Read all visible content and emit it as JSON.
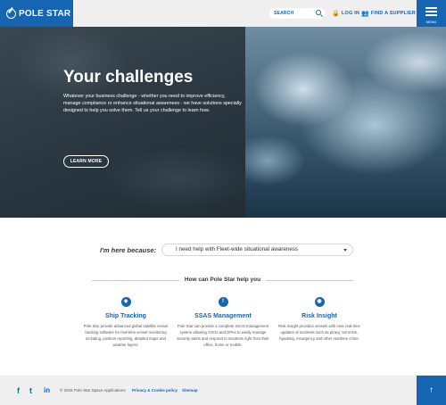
{
  "header": {
    "logo_text": "POLE STAR",
    "search_placeholder": "SEARCH",
    "login_label": "LOG IN",
    "supplier_label": "FIND A SUPPLIER",
    "menu_label": "MENU"
  },
  "hero": {
    "title": "Your challenges",
    "text": "Whatever your business challenge - whether you need to improve efficiency, manage compliance or enhance situational awareness - we have solutions specially designed to help you solve them. Tell us your challenge to learn how.",
    "button_label": "LEARN MORE"
  },
  "selector": {
    "label": "I'm here because:",
    "selected": "I need help with Fleet-wide situational awareness"
  },
  "how": {
    "title": "How can Pole Star help you"
  },
  "features": [
    {
      "icon": "ship-icon",
      "glyph": "◆",
      "title": "Ship Tracking",
      "text": "Pole Star provide advanced global satellite vessel tracking software for real-time vessel monitoring including, position reporting, detailed maps and weather layers."
    },
    {
      "icon": "alert-icon",
      "glyph": "!",
      "title": "SSAS Management",
      "text": "Pole Star can provide a complete SSAS management system allowing CSOs and DPAs to easily manage security alerts and respond to incidents right from their office, home or mobile."
    },
    {
      "icon": "eye-icon",
      "glyph": "◉",
      "title": "Risk Insight",
      "text": "Risk Insight provides vessels with near real-time updates of incidents such as piracy, terrorism, hijacking, insurgency and other maritime crime."
    }
  ],
  "footer": {
    "facebook": "f",
    "twitter": "t",
    "linkedin": "in",
    "copyright": "© 2016 Pole Star Space Applications",
    "privacy": "Privacy & Cookie policy",
    "sitemap": "Sitemap",
    "top_glyph": "↑"
  },
  "colors": {
    "brand": "#1565b3",
    "header_bg": "#efefef"
  }
}
